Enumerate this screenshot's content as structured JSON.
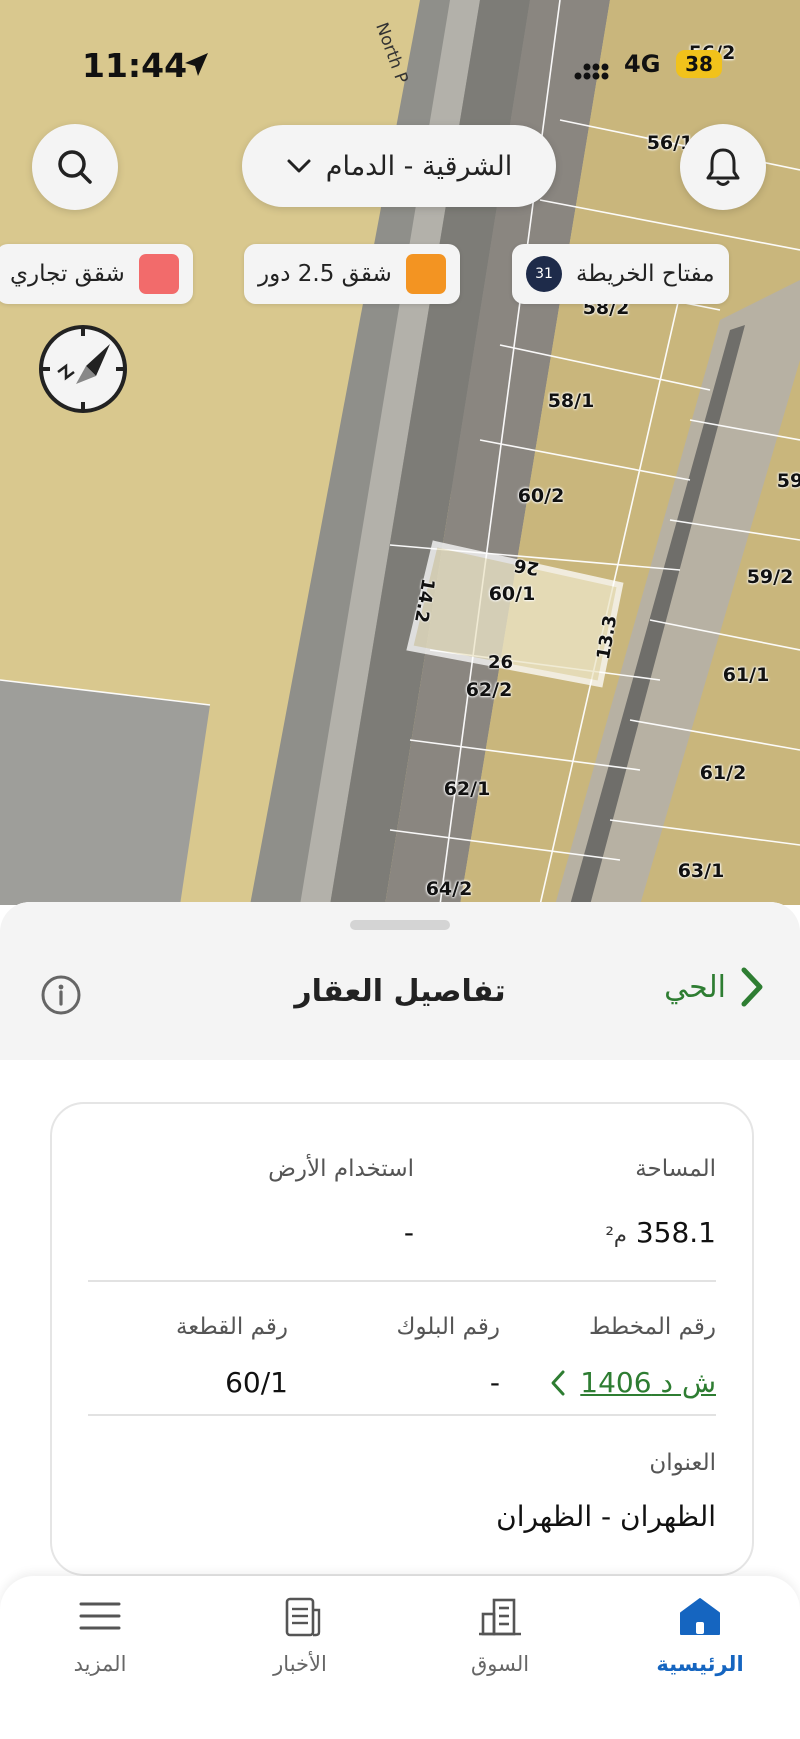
{
  "status_bar": {
    "time": "11:44",
    "network": "4G",
    "battery": "38"
  },
  "map": {
    "road_name": "North P",
    "plots": [
      "56/2",
      "56/1",
      "58/2",
      "58/1",
      "60/2",
      "60/1",
      "59/2",
      "59",
      "62/2",
      "61/1",
      "62/1",
      "61/2",
      "64/2",
      "63/1"
    ],
    "dimensions": {
      "top": "26",
      "bottom": "26",
      "left": "14.2",
      "right": "13.3"
    }
  },
  "top_controls": {
    "region": "الشرقية - الدمام",
    "icons": {
      "search": "search-icon",
      "bell": "bell-icon",
      "chevron": "chevron-down-icon",
      "compass": "compass-icon"
    }
  },
  "legend": [
    {
      "label": "مفتاح الخريطة",
      "badge": "31"
    },
    {
      "label": "شقق 2.5 دور",
      "color": "#f39422"
    },
    {
      "label": "شقق تجاري",
      "color": "#f26b6b"
    }
  ],
  "sheet": {
    "title": "تفاصيل العقار",
    "link": "الحي",
    "accent": "#2e7d32"
  },
  "details": {
    "area_label": "المساحة",
    "area_value": "358.1",
    "area_unit": "م²",
    "land_use_label": "استخدام الأرض",
    "land_use_value": "-",
    "plan_label": "رقم المخطط",
    "plan_value": "ش د 1406",
    "block_label": "رقم البلوك",
    "block_value": "-",
    "plot_label": "رقم القطعة",
    "plot_value": "60/1",
    "address_label": "العنوان",
    "address_value": "الظهران - الظهران"
  },
  "tabs": [
    {
      "label": "الرئيسية",
      "active": true
    },
    {
      "label": "السوق",
      "active": false
    },
    {
      "label": "الأخبار",
      "active": false
    },
    {
      "label": "المزيد",
      "active": false
    }
  ]
}
